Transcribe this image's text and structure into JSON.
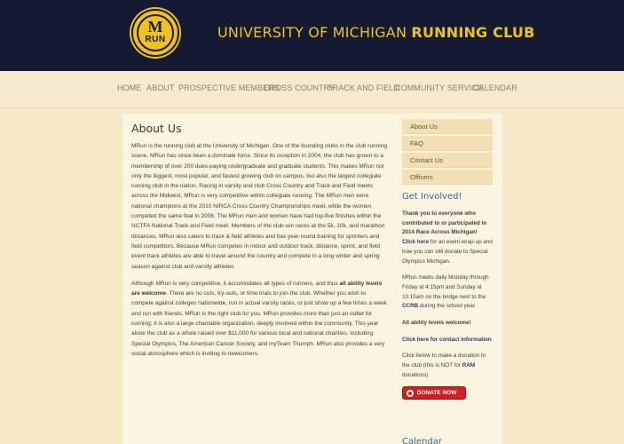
{
  "header": {
    "logo_top": "M",
    "logo_bottom": "RUN",
    "title_regular": "UNIVERSITY OF MICHIGAN",
    "title_bold": "RUNNING CLUB"
  },
  "nav": [
    "HOME",
    "ABOUT",
    "PROSPECTIVE MEMBERS",
    "CROSS COUNTRY",
    "TRACK AND FIELD",
    "COMMUNITY SERVICE",
    "CALENDAR"
  ],
  "main": {
    "title": "About Us",
    "p1": "MRun is the running club at the University of Michigan. One of the founding clubs in the club running scene, MRun has since been a dominate force. Since its inception in 2004, the club has grown to a membership of over 200 dues-paying undergraduate and graduate students. This makes MRun not only the biggest, most popular, and fastest growing club on campus, but also the largest collegiate running club in the nation. Racing in varsity and club Cross Country and Track and Field meets across the Midwest, MRun is very competitive within collegiate running. The MRun men were national champions at the 2010 NIRCA Cross Country Championships meet, while the women competed the same feat in 2008. The MRun men and women have had top-five finishes within the NCTFA National Track and Field meet. Members of the club win races at the 5k, 10k, and marathon distances. MRun also caters to track & field athletes and has year-round training for sprinters and field competitors. Because MRun competes in indoor and outdoor track, distance, sprint, and field event track athletes are able to travel around the country and compete in a long winter and spring season against club and varsity athletes.",
    "p2_a": "Although MRun is very competitive, it accomodates all types of runners, and thus ",
    "p2_bold": "all ability levels are welcome",
    "p2_b": ". There are no cuts, try-outs, or time trials to join the club. Whether you wish to compete against colleges nationwide, run in actual varsity races, or just show up a few times a week and run with friends, MRun is the right club for you. MRun provides more than just an outlet for running; it is also a large charitable organization, deeply involved within the community. This year alone the club as a whole raised over $11,000 for various local and national charities, including: Special Olympics, The American Cancer Society, and myTeam Triumph. MRun also provides a very social atmosphere which is inviting to newcomers."
  },
  "sidebar": {
    "menu": [
      "About Us",
      "FAQ",
      "Contact Us",
      "Officers"
    ],
    "heading": "Get Involved!",
    "thanks": "Thank you to everyone who contributed to or participated in 2014 Race Across Michigan!",
    "click_here": "Click here",
    "wrapup": " for an event wrap-up and how you can still donate to Special Olympics Michigan.",
    "meets": "MRun meets daily Monday through Friday at 4:15pm and Sunday at 10:15am on the bridge next to the ",
    "ccrb": "CCRB",
    "meets_end": " during the school year.",
    "welcome": "All ability levels welcome!",
    "contact": "Click here for contact information",
    "donate_text": "Click below to make a donation to the club (this is NOT for ",
    "ram": "RAM",
    "donate_end": " donations)",
    "donate_button": "DONATE NOW",
    "next_heading": "Calendar"
  },
  "colors": {
    "header_bg": "#131a32",
    "accent": "#f0c31a",
    "page_bg": "#f5e9c8",
    "link": "#24426a"
  }
}
